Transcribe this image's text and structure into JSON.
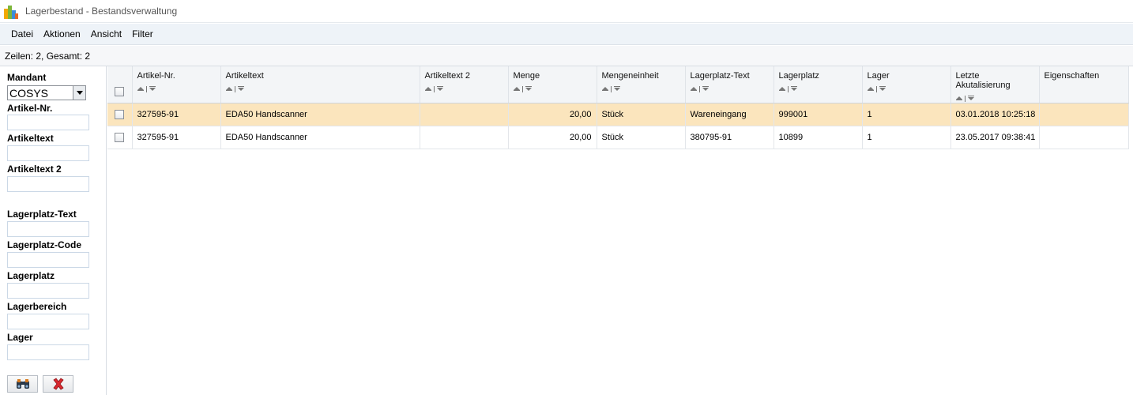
{
  "window": {
    "title": "Lagerbestand - Bestandsverwaltung"
  },
  "menu": [
    "Datei",
    "Aktionen",
    "Ansicht",
    "Filter"
  ],
  "status": {
    "text": "Zeilen: 2, Gesamt: 2"
  },
  "filters": {
    "mandant_label": "Mandant",
    "mandant_value": "COSYS",
    "artikel_nr_label": "Artikel-Nr.",
    "artikeltext_label": "Artikeltext",
    "artikeltext2_label": "Artikeltext 2",
    "lagerplatz_text_label": "Lagerplatz-Text",
    "lagerplatz_code_label": "Lagerplatz-Code",
    "lagerplatz_label": "Lagerplatz",
    "lagerbereich_label": "Lagerbereich",
    "lager_label": "Lager",
    "search_icon": "binoculars-icon",
    "clear_icon": "red-x-icon"
  },
  "table": {
    "columns": [
      "Artikel-Nr.",
      "Artikeltext",
      "Artikeltext 2",
      "Menge",
      "Mengeneinheit",
      "Lagerplatz-Text",
      "Lagerplatz",
      "Lager",
      "Letzte Akutalisierung",
      "Eigenschaften"
    ],
    "rows": [
      [
        "327595-91",
        "EDA50 Handscanner",
        "",
        "20,00",
        "Stück",
        "Wareneingang",
        "999001",
        "1",
        "03.01.2018 10:25:18",
        ""
      ],
      [
        "327595-91",
        "EDA50 Handscanner",
        "",
        "20,00",
        "Stück",
        "380795-91",
        "10899",
        "1",
        "23.05.2017 09:38:41",
        ""
      ]
    ],
    "selected_row_color": "#fbe5bd"
  }
}
